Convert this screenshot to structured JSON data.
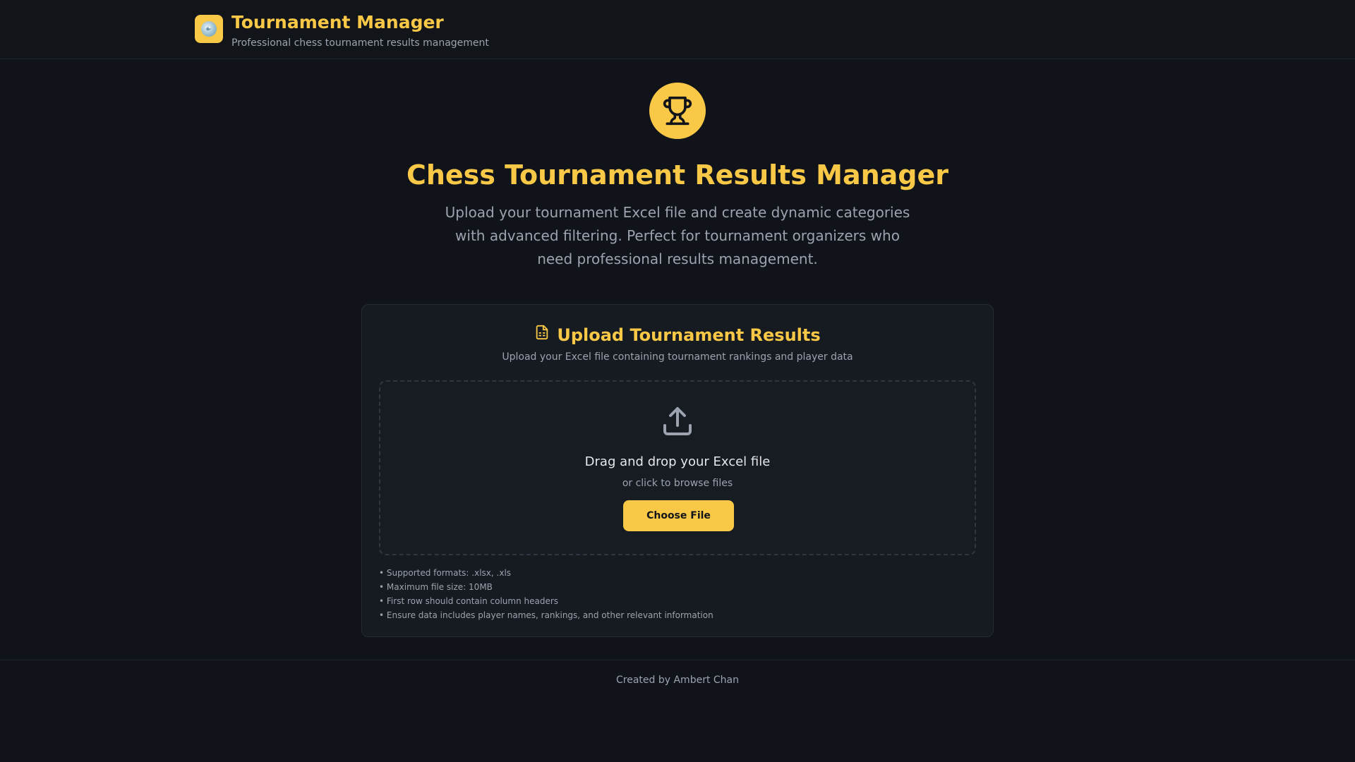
{
  "header": {
    "logo_icon": "chess-globe-icon",
    "title": "Tournament Manager",
    "subtitle": "Professional chess tournament results management"
  },
  "hero": {
    "icon": "trophy-icon",
    "title": "Chess Tournament Results Manager",
    "description": "Upload your tournament Excel file and create dynamic categories with advanced filtering. Perfect for tournament organizers who need professional results management."
  },
  "upload_card": {
    "icon": "file-spreadsheet-icon",
    "title": "Upload Tournament Results",
    "subtitle": "Upload your Excel file containing tournament rankings and player data",
    "dropzone": {
      "icon": "upload-icon",
      "title": "Drag and drop your Excel file",
      "subtitle": "or click to browse files",
      "button_label": "Choose File"
    },
    "notes": [
      "• Supported formats: .xlsx, .xls",
      "• Maximum file size: 10MB",
      "• First row should contain column headers",
      "• Ensure data includes player names, rankings, and other relevant information"
    ]
  },
  "footer": {
    "text": "Created by Ambert Chan"
  },
  "colors": {
    "accent": "#f9c846",
    "background": "#10131a",
    "card": "#161a21",
    "muted_text": "#9ca3af"
  }
}
